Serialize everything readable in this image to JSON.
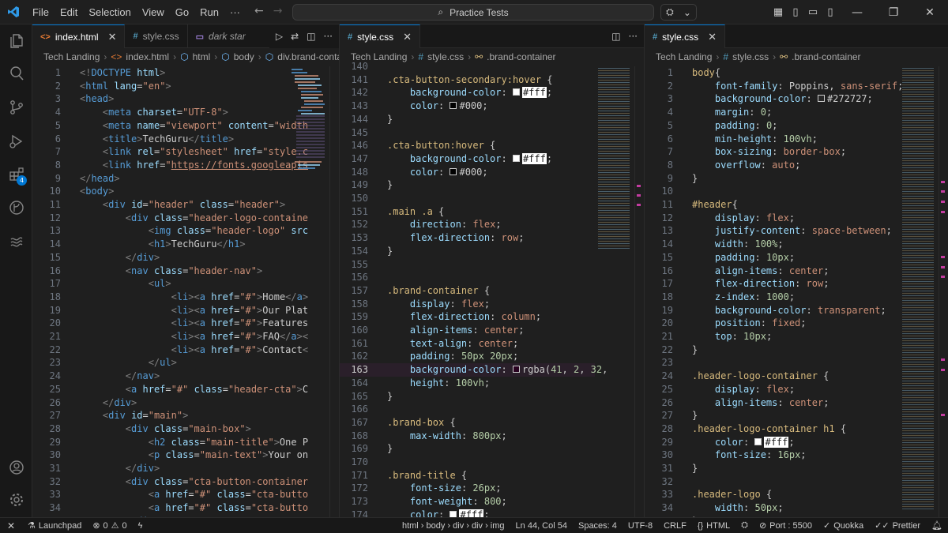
{
  "titlebar": {
    "menus": [
      "File",
      "Edit",
      "Selection",
      "View",
      "Go",
      "Run",
      "···"
    ],
    "search": "Practice Tests",
    "copilot_chevron": "⌄"
  },
  "activity_bar": {
    "items": [
      "explorer-icon",
      "search-icon",
      "source-control-icon",
      "run-debug-icon",
      "extensions-icon",
      "git-graph-icon",
      "live-share-icon"
    ],
    "extensions_badge": "4",
    "bottom": [
      "account-icon",
      "settings-gear-icon"
    ]
  },
  "groups": [
    {
      "tabs": [
        {
          "icon": "<>",
          "label": "index.html",
          "active": true
        },
        {
          "icon": "#",
          "label": "style.css",
          "active": false
        },
        {
          "icon": "▭",
          "label": "dark star",
          "active": false,
          "italic": true
        }
      ],
      "breadcrumb": [
        "Tech Landing",
        "index.html",
        "html",
        "body",
        "div.brand-conta"
      ]
    },
    {
      "tabs": [
        {
          "icon": "#",
          "label": "style.css",
          "active": true
        }
      ],
      "breadcrumb": [
        "Tech Landing",
        "style.css",
        ".brand-container"
      ]
    },
    {
      "tabs": [
        {
          "icon": "#",
          "label": "style.css",
          "active": true
        }
      ],
      "breadcrumb": [
        "Tech Landing",
        "style.css",
        ".brand-container"
      ]
    }
  ],
  "statusbar": {
    "launchpad": "Launchpad",
    "errors": "0",
    "warnings": "0",
    "path": "html › body › div › div › img",
    "position": "Ln 44, Col 54",
    "spaces": "Spaces: 4",
    "encoding": "UTF-8",
    "eol": "CRLF",
    "language": "HTML",
    "port": "Port : 5500",
    "quokka": "Quokka",
    "prettier": "Prettier"
  }
}
